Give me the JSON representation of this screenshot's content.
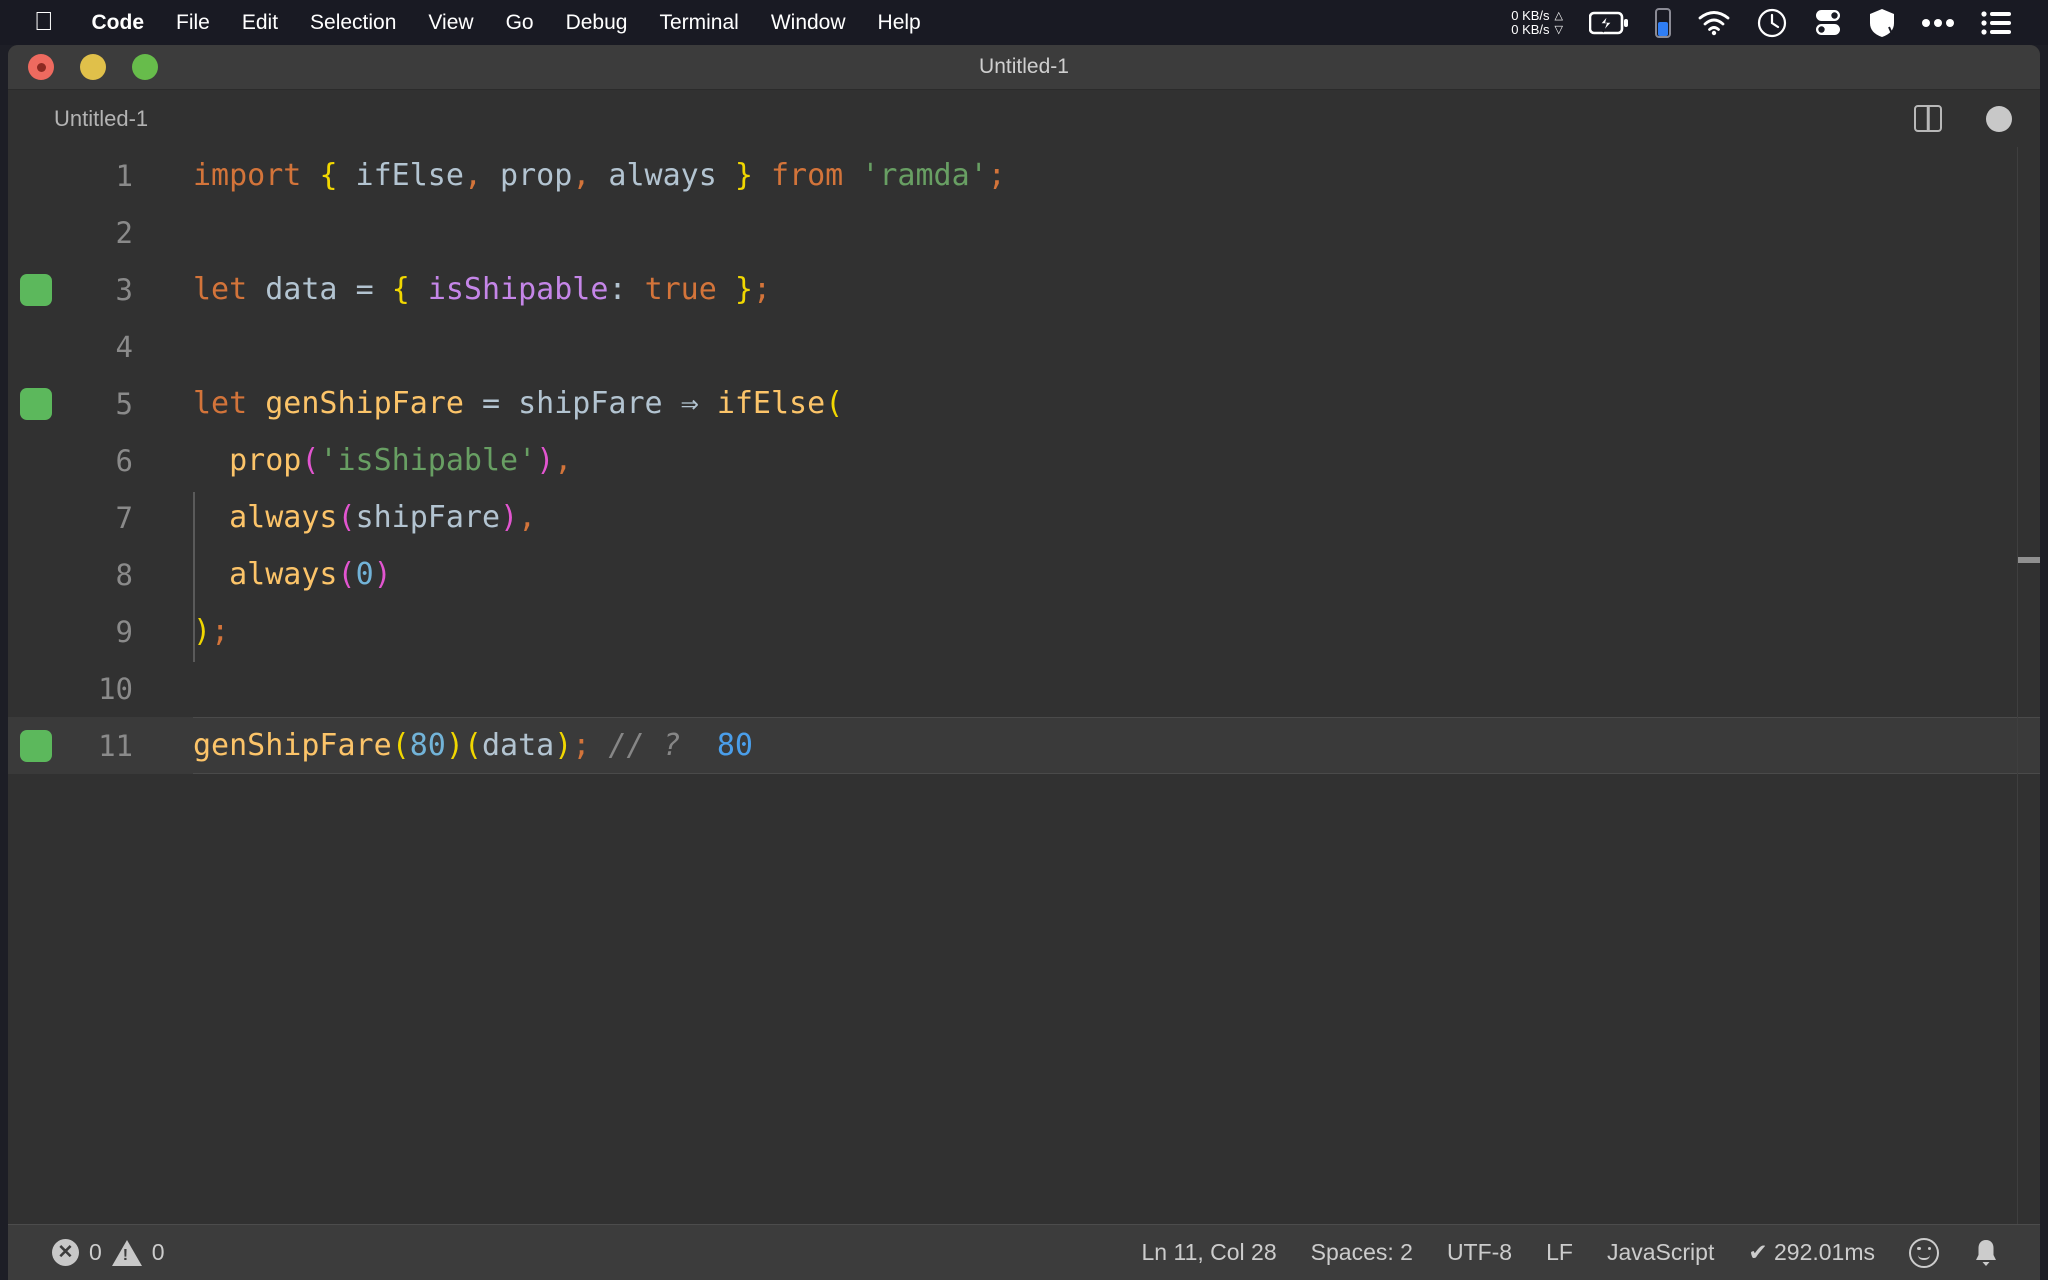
{
  "menubar": {
    "apple_icon": "apple-logo",
    "items": [
      {
        "label": "Code",
        "bold": true
      },
      {
        "label": "File",
        "bold": false
      },
      {
        "label": "Edit",
        "bold": false
      },
      {
        "label": "Selection",
        "bold": false
      },
      {
        "label": "View",
        "bold": false
      },
      {
        "label": "Go",
        "bold": false
      },
      {
        "label": "Debug",
        "bold": false
      },
      {
        "label": "Terminal",
        "bold": false
      },
      {
        "label": "Window",
        "bold": false
      },
      {
        "label": "Help",
        "bold": false
      }
    ],
    "status": {
      "net_up": "0 KB/s",
      "net_down": "0 KB/s",
      "up_arrow": "△",
      "down_arrow": "▽",
      "battery_icon": "battery-charging-icon",
      "battery_level_icon": "battery-vertical-icon",
      "wifi_icon": "wifi-icon",
      "clock_icon": "clock-icon",
      "toggles_icon": "control-center-icon",
      "shield_icon": "shield-icon",
      "more_icon": "ellipsis-icon",
      "list_icon": "list-icon"
    }
  },
  "window": {
    "title": "Untitled-1",
    "traffic": {
      "close": "close-button",
      "minimize": "minimize-button",
      "zoom": "zoom-button"
    }
  },
  "tabbar": {
    "tab_label": "Untitled-1",
    "split_label": "split-editor",
    "dirty_label": "unsaved-changes"
  },
  "editor": {
    "lines": [
      {
        "number": "1",
        "breakpoint": false,
        "active": false,
        "tokens": [
          {
            "t": "import",
            "c": "t-kw"
          },
          {
            "t": " ",
            "c": "t-plain"
          },
          {
            "t": "{",
            "c": "t-brace"
          },
          {
            "t": " ifElse",
            "c": "t-var"
          },
          {
            "t": ",",
            "c": "t-punc"
          },
          {
            "t": " prop",
            "c": "t-var"
          },
          {
            "t": ",",
            "c": "t-punc"
          },
          {
            "t": " always ",
            "c": "t-var"
          },
          {
            "t": "}",
            "c": "t-brace"
          },
          {
            "t": " ",
            "c": "t-plain"
          },
          {
            "t": "from",
            "c": "t-kw"
          },
          {
            "t": " ",
            "c": "t-plain"
          },
          {
            "t": "'ramda'",
            "c": "t-str"
          },
          {
            "t": ";",
            "c": "t-punc"
          }
        ]
      },
      {
        "number": "2",
        "breakpoint": false,
        "active": false,
        "tokens": []
      },
      {
        "number": "3",
        "breakpoint": true,
        "active": false,
        "tokens": [
          {
            "t": "let",
            "c": "t-kw"
          },
          {
            "t": " data ",
            "c": "t-var"
          },
          {
            "t": "=",
            "c": "t-plain"
          },
          {
            "t": " ",
            "c": "t-plain"
          },
          {
            "t": "{",
            "c": "t-brace"
          },
          {
            "t": " ",
            "c": "t-plain"
          },
          {
            "t": "isShipable",
            "c": "t-prop"
          },
          {
            "t": ":",
            "c": "t-plain"
          },
          {
            "t": " ",
            "c": "t-plain"
          },
          {
            "t": "true",
            "c": "t-kw"
          },
          {
            "t": " ",
            "c": "t-plain"
          },
          {
            "t": "}",
            "c": "t-brace"
          },
          {
            "t": ";",
            "c": "t-punc"
          }
        ]
      },
      {
        "number": "4",
        "breakpoint": false,
        "active": false,
        "tokens": []
      },
      {
        "number": "5",
        "breakpoint": true,
        "active": false,
        "tokens": [
          {
            "t": "let",
            "c": "t-kw"
          },
          {
            "t": " ",
            "c": "t-plain"
          },
          {
            "t": "genShipFare",
            "c": "t-func"
          },
          {
            "t": " ",
            "c": "t-plain"
          },
          {
            "t": "=",
            "c": "t-plain"
          },
          {
            "t": " shipFare ",
            "c": "t-var"
          },
          {
            "t": "⇒",
            "c": "t-var"
          },
          {
            "t": " ",
            "c": "t-plain"
          },
          {
            "t": "ifElse",
            "c": "t-func"
          },
          {
            "t": "(",
            "c": "t-brace"
          }
        ]
      },
      {
        "number": "6",
        "breakpoint": false,
        "active": false,
        "tokens": [
          {
            "t": "  ",
            "c": "t-plain"
          },
          {
            "t": "prop",
            "c": "t-func"
          },
          {
            "t": "(",
            "c": "t-paren2"
          },
          {
            "t": "'isShipable'",
            "c": "t-str"
          },
          {
            "t": ")",
            "c": "t-paren2"
          },
          {
            "t": ",",
            "c": "t-punc"
          }
        ]
      },
      {
        "number": "7",
        "breakpoint": false,
        "active": false,
        "tokens": [
          {
            "t": "  ",
            "c": "t-plain"
          },
          {
            "t": "always",
            "c": "t-func"
          },
          {
            "t": "(",
            "c": "t-paren2"
          },
          {
            "t": "shipFare",
            "c": "t-var"
          },
          {
            "t": ")",
            "c": "t-paren2"
          },
          {
            "t": ",",
            "c": "t-punc"
          }
        ]
      },
      {
        "number": "8",
        "breakpoint": false,
        "active": false,
        "tokens": [
          {
            "t": "  ",
            "c": "t-plain"
          },
          {
            "t": "always",
            "c": "t-func"
          },
          {
            "t": "(",
            "c": "t-paren2"
          },
          {
            "t": "0",
            "c": "t-num"
          },
          {
            "t": ")",
            "c": "t-paren2"
          }
        ]
      },
      {
        "number": "9",
        "breakpoint": false,
        "active": false,
        "tokens": [
          {
            "t": ")",
            "c": "t-brace"
          },
          {
            "t": ";",
            "c": "t-punc"
          }
        ]
      },
      {
        "number": "10",
        "breakpoint": false,
        "active": false,
        "tokens": []
      },
      {
        "number": "11",
        "breakpoint": true,
        "active": true,
        "tokens": [
          {
            "t": "genShipFare",
            "c": "t-func"
          },
          {
            "t": "(",
            "c": "t-brace"
          },
          {
            "t": "80",
            "c": "t-num"
          },
          {
            "t": ")",
            "c": "t-brace"
          },
          {
            "t": "(",
            "c": "t-brace"
          },
          {
            "t": "data",
            "c": "t-var"
          },
          {
            "t": ")",
            "c": "t-brace"
          },
          {
            "t": ";",
            "c": "t-punc"
          },
          {
            "t": " ",
            "c": "t-plain"
          },
          {
            "t": "// ?",
            "c": "t-comment"
          },
          {
            "t": "  ",
            "c": "t-plain"
          },
          {
            "t": "80",
            "c": "t-inline"
          }
        ]
      }
    ]
  },
  "statusbar": {
    "errors": "0",
    "warnings": "0",
    "cursor": "Ln 11, Col 28",
    "indent": "Spaces: 2",
    "encoding": "UTF-8",
    "eol": "LF",
    "language": "JavaScript",
    "quokka": "✔ 292.01ms",
    "feedback_icon": "smiley-icon",
    "bell": "🔔"
  },
  "colors": {
    "menubar_bg": "#191a23",
    "titlebar_bg": "#3c3c3c",
    "editor_bg": "#313131",
    "statusbar_bg": "#3c3c3c",
    "breakpoint_green": "#5cb85c",
    "active_line": "#3a3a3a"
  }
}
